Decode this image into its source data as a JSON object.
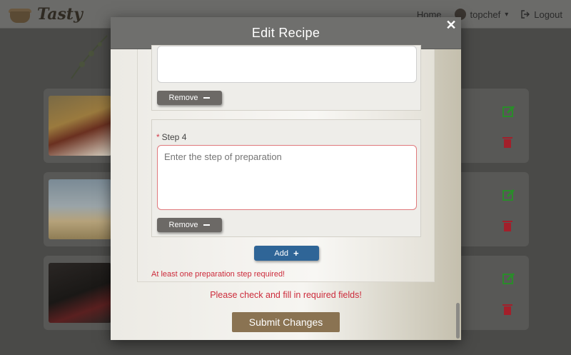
{
  "navbar": {
    "brand": "Tasty",
    "links": {
      "home": "Home",
      "user": "topchef",
      "logout": "Logout"
    }
  },
  "modal": {
    "title": "Edit Recipe",
    "close_symbol": "✕",
    "steps": [
      {
        "label": "",
        "remove_label": "Remove"
      },
      {
        "label": "Step 4",
        "required_star": "*",
        "placeholder": "Enter the step of preparation",
        "value": "",
        "remove_label": "Remove"
      }
    ],
    "add_label": "Add",
    "step_error": "At least one preparation step required!",
    "form_error": "Please check and fill in required fields!",
    "submit_label": "Submit Changes"
  },
  "colors": {
    "accent_brown": "#8a7352",
    "add_blue": "#2f6597",
    "error_red": "#cc2b3b",
    "edit_green": "#2a8c2a",
    "delete_red": "#a31f2a"
  },
  "icons": [
    "close-icon",
    "minus-icon",
    "plus-icon",
    "edit-icon",
    "trash-icon",
    "logout-icon",
    "chevron-down-icon"
  ]
}
